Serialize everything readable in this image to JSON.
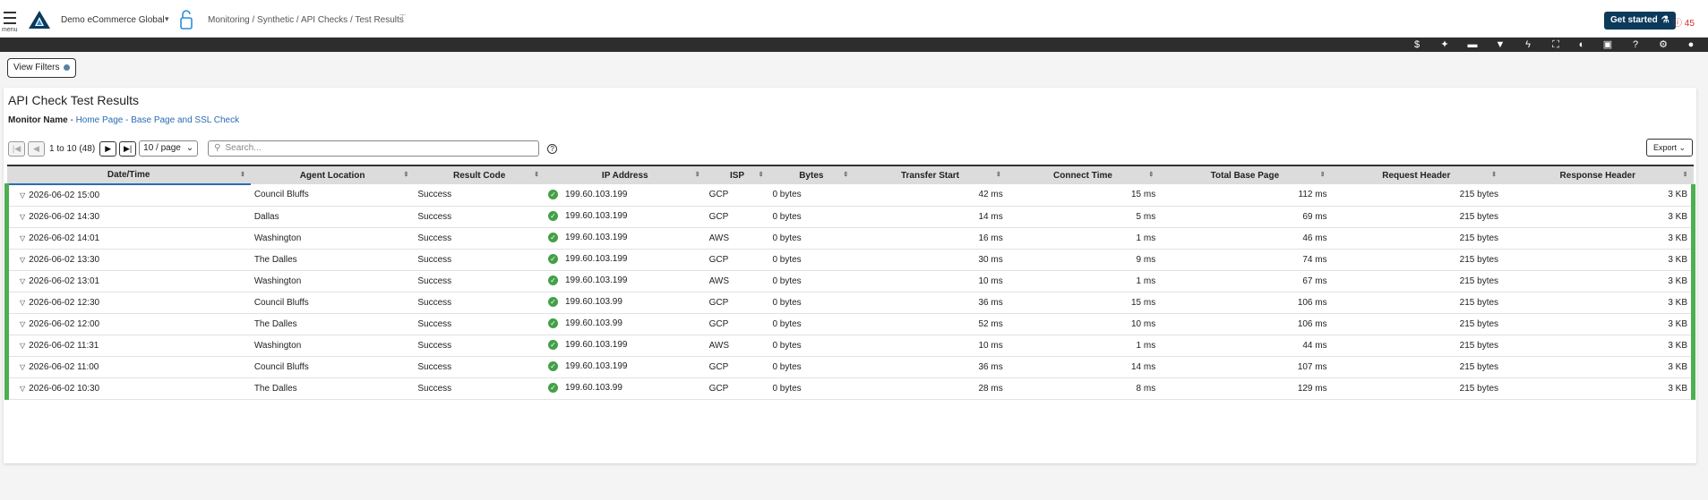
{
  "nav": {
    "menu_label": "menu",
    "org_name": "Demo eCommerce Global",
    "breadcrumb": "Monitoring / Synthetic / API Checks / Test Results",
    "get_started": "Get started",
    "alert_count": "45"
  },
  "toolbar": {
    "icons": [
      "dollar-icon",
      "magic-icon",
      "chat-icon",
      "filter-icon",
      "bolt-icon",
      "fullscreen-icon",
      "contrast-icon",
      "panel-icon",
      "help-icon",
      "settings-icon",
      "user-icon"
    ]
  },
  "filters": {
    "label": "View Filters"
  },
  "page": {
    "title": "API Check Test Results",
    "monitor_label": "Monitor Name",
    "monitor_sep": " - ",
    "monitor_value": "Home Page - Base Page and SSL Check"
  },
  "pager": {
    "range": "1 to 10 (48)",
    "per_page": "10 / page",
    "search_placeholder": "Search...",
    "export": "Export"
  },
  "table": {
    "columns": [
      "Date/Time",
      "Agent Location",
      "Result Code",
      "IP Address",
      "ISP",
      "Bytes",
      "Transfer Start",
      "Connect Time",
      "Total Base Page",
      "Request Header",
      "Response Header"
    ],
    "rows": [
      [
        "2026-06-02 15:00",
        "Council Bluffs",
        "Success",
        "199.60.103.199",
        "GCP",
        "0 bytes",
        "42 ms",
        "15 ms",
        "112 ms",
        "215 bytes",
        "3 KB"
      ],
      [
        "2026-06-02 14:30",
        "Dallas",
        "Success",
        "199.60.103.199",
        "GCP",
        "0 bytes",
        "14 ms",
        "5 ms",
        "69 ms",
        "215 bytes",
        "3 KB"
      ],
      [
        "2026-06-02 14:01",
        "Washington",
        "Success",
        "199.60.103.199",
        "AWS",
        "0 bytes",
        "16 ms",
        "1 ms",
        "46 ms",
        "215 bytes",
        "3 KB"
      ],
      [
        "2026-06-02 13:30",
        "The Dalles",
        "Success",
        "199.60.103.199",
        "GCP",
        "0 bytes",
        "30 ms",
        "9 ms",
        "74 ms",
        "215 bytes",
        "3 KB"
      ],
      [
        "2026-06-02 13:01",
        "Washington",
        "Success",
        "199.60.103.199",
        "AWS",
        "0 bytes",
        "10 ms",
        "1 ms",
        "67 ms",
        "215 bytes",
        "3 KB"
      ],
      [
        "2026-06-02 12:30",
        "Council Bluffs",
        "Success",
        "199.60.103.99",
        "GCP",
        "0 bytes",
        "36 ms",
        "15 ms",
        "106 ms",
        "215 bytes",
        "3 KB"
      ],
      [
        "2026-06-02 12:00",
        "The Dalles",
        "Success",
        "199.60.103.99",
        "GCP",
        "0 bytes",
        "52 ms",
        "10 ms",
        "106 ms",
        "215 bytes",
        "3 KB"
      ],
      [
        "2026-06-02 11:31",
        "Washington",
        "Success",
        "199.60.103.199",
        "AWS",
        "0 bytes",
        "10 ms",
        "1 ms",
        "44 ms",
        "215 bytes",
        "3 KB"
      ],
      [
        "2026-06-02 11:00",
        "Council Bluffs",
        "Success",
        "199.60.103.199",
        "GCP",
        "0 bytes",
        "36 ms",
        "14 ms",
        "107 ms",
        "215 bytes",
        "3 KB"
      ],
      [
        "2026-06-02 10:30",
        "The Dalles",
        "Success",
        "199.60.103.99",
        "GCP",
        "0 bytes",
        "28 ms",
        "8 ms",
        "129 ms",
        "215 bytes",
        "3 KB"
      ]
    ]
  },
  "colors": {
    "success": "#4caf50",
    "brand": "#0b3a5b",
    "link": "#2a6db5",
    "alert": "#d32f2f"
  }
}
